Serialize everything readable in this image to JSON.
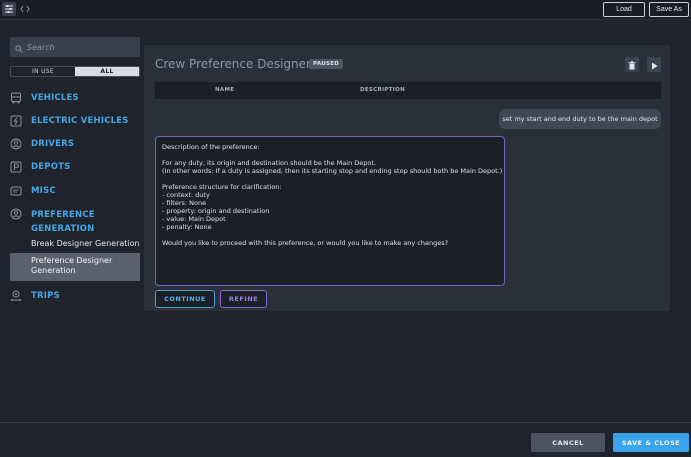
{
  "toolbar": {
    "load_label": "Load",
    "save_as_label": "Save As"
  },
  "sidebar": {
    "search_placeholder": "Search",
    "filter": {
      "in_use": "IN USE",
      "all": "ALL",
      "selected": "ALL"
    },
    "items": [
      {
        "label": "VEHICLES",
        "icon": "bus-icon"
      },
      {
        "label": "ELECTRIC VEHICLES",
        "icon": "lightning-icon"
      },
      {
        "label": "DRIVERS",
        "icon": "person-icon"
      },
      {
        "label": "DEPOTS",
        "icon": "parking-icon"
      },
      {
        "label": "MISC",
        "icon": "misc-icon"
      },
      {
        "label": "PREFERENCE",
        "label2": "GENERATION",
        "icon": "person-circle-icon"
      },
      {
        "label": "TRIPS",
        "icon": "route-icon"
      }
    ],
    "sub_items": [
      {
        "label": "Break Designer Generation"
      },
      {
        "label": "Preference Designer",
        "label2": "Generation",
        "selected": true
      }
    ]
  },
  "panel": {
    "title": "Crew Preference Designer",
    "status_badge": "PAUSED",
    "table_headers": {
      "name": "NAME",
      "description": "DESCRIPTION"
    },
    "user_message": "set my start and end duty to be the main depot",
    "bot_message": {
      "l1": "Description of the preference:",
      "l2": "For any duty, its origin and destination should be the Main Depot.",
      "l3": "(In other words: If a duty is assigned, then its starting stop and ending stop should both be Main Depot.)",
      "l4": "Preference structure for clarification:",
      "l5": "- context: duty",
      "l6": "- filters: None",
      "l7": "- property: origin and destination",
      "l8": "- value: Main Depot",
      "l9": "- penalty: None",
      "l10": "Would you like to proceed with this preference, or would you like to make any changes?"
    },
    "continue_label": "CONTINUE",
    "refine_label": "REFINE"
  },
  "footer": {
    "cancel_label": "CANCEL",
    "save_close_label": "SAVE & CLOSE"
  },
  "colors": {
    "accent_blue": "#45a7e6",
    "refine_purple": "#8a68d8",
    "save_button": "#3ba3ea",
    "background": "#1f232b",
    "panel": "#293038"
  }
}
